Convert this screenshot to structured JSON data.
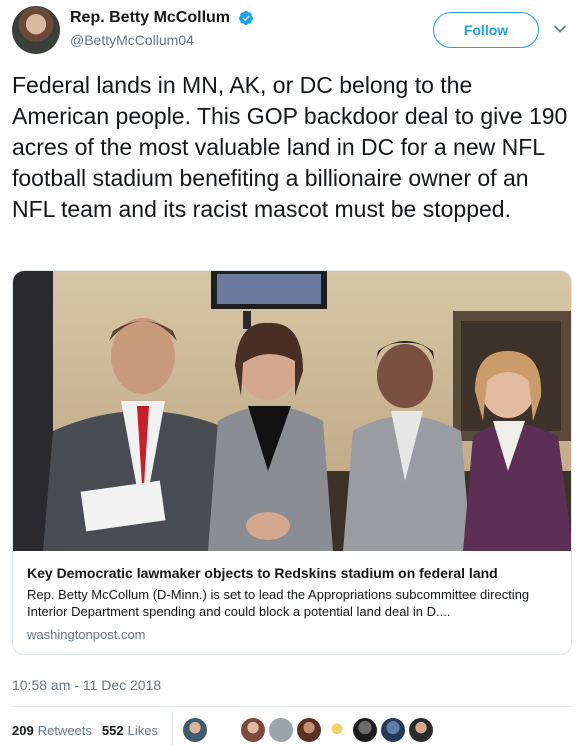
{
  "author": {
    "display_name": "Rep. Betty McCollum",
    "handle": "@BettyMcCollum04",
    "verified": true
  },
  "actions": {
    "follow_label": "Follow",
    "menu_icon": "chevron-down-icon"
  },
  "tweet": {
    "text": "Federal lands in MN, AK, or DC belong to the American people. This GOP backdoor deal to give 190 acres of the most valuable land in DC for a new NFL football stadium benefiting a billionaire owner of an NFL team and its racist mascot must be stopped.",
    "timestamp": "10:58 am - 11 Dec 2018"
  },
  "card": {
    "title": "Key Democratic lawmaker objects to Redskins stadium on federal land",
    "description": "Rep. Betty McCollum (D-Minn.) is set to lead the Appropriations subcommittee directing Interior Department spending and could block a potential land deal in D....",
    "domain": "washingtonpost.com"
  },
  "stats": {
    "retweets_count": "209",
    "retweets_label": "Retweets",
    "likes_count": "552",
    "likes_label": "Likes"
  },
  "colors": {
    "accent": "#1da1f2",
    "muted": "#657786",
    "text": "#14171a"
  }
}
